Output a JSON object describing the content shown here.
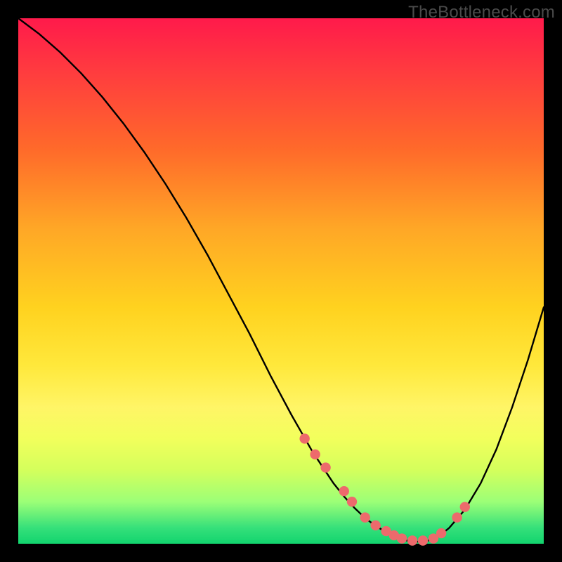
{
  "watermark": "TheBottleneck.com",
  "colors": {
    "frame": "#000000",
    "curve": "#000000",
    "marker_fill": "#ed6a6c",
    "marker_stroke": "#ed6a6c"
  },
  "chart_data": {
    "type": "line",
    "title": "",
    "xlabel": "",
    "ylabel": "",
    "xlim": [
      0,
      100
    ],
    "ylim": [
      0,
      100
    ],
    "grid": false,
    "legend": false,
    "series": [
      {
        "name": "bottleneck-curve",
        "x": [
          0,
          4,
          8,
          12,
          16,
          20,
          24,
          28,
          32,
          36,
          40,
          44,
          48,
          52,
          54,
          56,
          58,
          60,
          62,
          64,
          66,
          68,
          70,
          72,
          74,
          76,
          78,
          80,
          82,
          85,
          88,
          91,
          94,
          97,
          100
        ],
        "y": [
          100,
          97,
          93.5,
          89.5,
          85,
          80,
          74.5,
          68.5,
          62,
          55,
          47.5,
          40,
          32,
          24.5,
          21,
          17.5,
          14.5,
          11.5,
          9,
          6.8,
          4.9,
          3.4,
          2.2,
          1.2,
          0.6,
          0.4,
          0.6,
          1.4,
          3,
          6.5,
          11.5,
          18,
          26,
          35,
          45
        ]
      }
    ],
    "markers": {
      "name": "highlight-points",
      "x": [
        54.5,
        56.5,
        58.5,
        62.0,
        63.5,
        66.0,
        68.0,
        70.0,
        71.5,
        73.0,
        75.0,
        77.0,
        79.0,
        80.5,
        83.5,
        85.0
      ],
      "y": [
        20.0,
        17.0,
        14.5,
        10.0,
        8.0,
        5.0,
        3.5,
        2.4,
        1.6,
        1.0,
        0.6,
        0.6,
        1.0,
        2.0,
        5.0,
        7.0
      ]
    }
  }
}
